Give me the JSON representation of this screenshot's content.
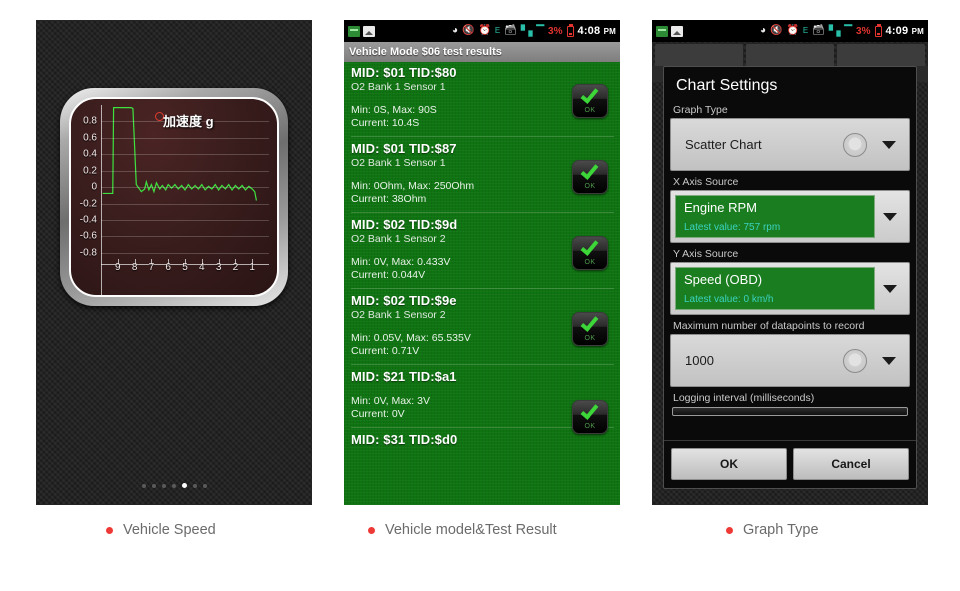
{
  "panel1": {
    "name": "Vehicle Speed gauge screen",
    "chart_data": {
      "type": "line",
      "title": "加速度 g",
      "series_label": "加速度 g",
      "xlabel": "",
      "ylabel": "",
      "ylim": [
        -0.9,
        1.0
      ],
      "ytick_labels": [
        "0.8",
        "0.6",
        "0.4",
        "0.2",
        "0",
        "-0.2",
        "-0.4",
        "-0.6",
        "-0.8"
      ],
      "ytick_values": [
        0.8,
        0.6,
        0.4,
        0.2,
        0,
        -0.2,
        -0.4,
        -0.6,
        -0.8
      ],
      "xtick_labels": [
        "9",
        "8",
        "7",
        "6",
        "5",
        "4",
        "3",
        "2",
        "1"
      ],
      "xtick_values": [
        9,
        8,
        7,
        6,
        5,
        4,
        3,
        2,
        1
      ],
      "grid": true,
      "line_color": "#3ee23e",
      "background": "#3a1d1d",
      "x": [
        9.9,
        9.3,
        9.25,
        8.2,
        8.1,
        7.9,
        7.6,
        7.4,
        7.3,
        7.15,
        7.0,
        6.85,
        6.7,
        6.5,
        6.35,
        6.15,
        6.0,
        5.8,
        5.6,
        5.4,
        5.2,
        5.0,
        4.8,
        4.6,
        4.4,
        4.2,
        4.0,
        3.8,
        3.6,
        3.4,
        3.2,
        3.0,
        2.8,
        2.6,
        2.4,
        2.2,
        2.0,
        1.8,
        1.6,
        1.4,
        1.2,
        1.0,
        0.85,
        0.75
      ],
      "y": [
        0.0,
        0.0,
        0.97,
        0.97,
        0.96,
        0.1,
        0.02,
        0.05,
        0.13,
        0.04,
        0.1,
        0.02,
        0.12,
        0.05,
        0.09,
        0.04,
        0.1,
        0.06,
        0.1,
        0.05,
        0.09,
        0.04,
        0.1,
        0.05,
        0.09,
        0.05,
        0.1,
        0.04,
        0.08,
        0.05,
        0.1,
        0.04,
        0.09,
        0.05,
        0.1,
        0.04,
        0.09,
        0.05,
        0.09,
        0.04,
        0.08,
        0.05,
        0.02,
        -0.08
      ],
      "marker": {
        "x": 8.2,
        "y": 0.97,
        "color": "#e23b2e",
        "shape": "circle-outline"
      }
    },
    "page_indicator": {
      "count": 7,
      "active_index": 4
    }
  },
  "panel2": {
    "statusbar": {
      "notifications": [
        "app-notification-icon",
        "screenshot-icon"
      ],
      "icons": [
        "bluetooth-icon",
        "mute-icon",
        "alarm-icon",
        "edge-data-icon",
        "sdcard-lock-icon",
        "signal-2g-icon"
      ],
      "battery_percent": "3%",
      "time": "4:08",
      "meridiem": "PM",
      "signal_color": "#29bfa8",
      "battery_color": "#e3342f"
    },
    "title": "Vehicle Mode $06 test results",
    "results": [
      {
        "mid": "MID: $01  TID:$80",
        "sensor": "O2 Bank 1 Sensor 1",
        "range": "Min: 0S, Max: 90S",
        "current": "Current: 10.4S",
        "status": "OK"
      },
      {
        "mid": "MID: $01  TID:$87",
        "sensor": "O2 Bank 1 Sensor 1",
        "range": "Min: 0Ohm, Max: 250Ohm",
        "current": "Current: 38Ohm",
        "status": "OK"
      },
      {
        "mid": "MID: $02  TID:$9d",
        "sensor": "O2 Bank 1 Sensor 2",
        "range": "Min: 0V, Max: 0.433V",
        "current": "Current: 0.044V",
        "status": "OK"
      },
      {
        "mid": "MID: $02  TID:$9e",
        "sensor": "O2 Bank 1 Sensor 2",
        "range": "Min: 0.05V, Max: 65.535V",
        "current": "Current: 0.71V",
        "status": "OK"
      },
      {
        "mid": "MID: $21  TID:$a1",
        "sensor": "",
        "range": "Min: 0V, Max: 3V",
        "current": "Current: 0V",
        "status": "OK"
      },
      {
        "mid": "MID: $31  TID:$d0",
        "sensor": "",
        "range": "",
        "current": "",
        "status": ""
      }
    ]
  },
  "panel3": {
    "statusbar": {
      "battery_percent": "3%",
      "time": "4:09",
      "meridiem": "PM"
    },
    "dialog_title": "Chart Settings",
    "fields": {
      "graph_type": {
        "label": "Graph Type",
        "value": "Scatter Chart"
      },
      "x_axis": {
        "label": "X Axis Source",
        "value": "Engine RPM",
        "latest": "Latest value: 757 rpm"
      },
      "y_axis": {
        "label": "Y Axis Source",
        "value": "Speed (OBD)",
        "latest": "Latest value: 0 km/h"
      },
      "max_datapoints": {
        "label": "Maximum number of datapoints to record",
        "value": "1000"
      },
      "logging_interval": {
        "label": "Logging interval (milliseconds)"
      }
    },
    "buttons": {
      "ok": "OK",
      "cancel": "Cancel"
    }
  },
  "captions": [
    {
      "text": "Vehicle Speed"
    },
    {
      "text": "Vehicle model&Test Result"
    },
    {
      "text": "Graph Type"
    }
  ],
  "theme": {
    "accent": "#ee3a36",
    "green": "#0f7311",
    "caption_text": "#6b6b6b"
  }
}
